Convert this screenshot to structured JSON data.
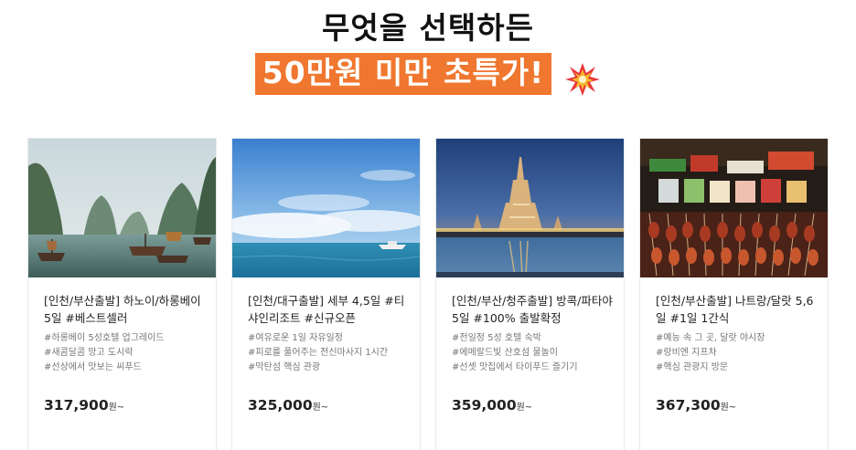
{
  "header": {
    "line1": "무엇을 선택하든",
    "line2": "50만원 미만 초특가!",
    "accent_color": "#f0772f",
    "icon": "explosion-burst-icon"
  },
  "cards": [
    {
      "image": "halong-bay-photo",
      "title": "[인천/부산출발] 하노이/하롱베이 5일 #베스트셀러",
      "tags": [
        "#하롱베이 5성호텔 업그레이드",
        "#새콤달콤 망고 도시락",
        "#선상에서 맛보는 씨푸드"
      ],
      "price": "317,900",
      "unit": "원~"
    },
    {
      "image": "cebu-sea-photo",
      "title": "[인천/대구출발] 세부 4,5일 #티샤인리조트 #신규오픈",
      "tags": [
        "#여유로운 1일 자유일정",
        "#피로를 풀어주는 전신마사지 1시간",
        "#막탄섬 핵심 관광"
      ],
      "price": "325,000",
      "unit": "원~"
    },
    {
      "image": "bangkok-temple-photo",
      "title": "[인천/부산/청주출발] 방콕/파타야 5일 #100% 출발확정",
      "tags": [
        "#전일정 5성 호텔 숙박",
        "#에메랄드빛 산호섬 물놀이",
        "#선셋 맛집에서 타이푸드 즐기기"
      ],
      "price": "359,000",
      "unit": "원~"
    },
    {
      "image": "night-market-food-photo",
      "title": "[인천/부산출발] 나트랑/달랏 5,6일 #1일 1간식",
      "tags": [
        "#예능 속 그 곳, 달랏 야시장",
        "#랑비엔 지프차",
        "#핵심 관광지 방문"
      ],
      "price": "367,300",
      "unit": "원~"
    }
  ]
}
